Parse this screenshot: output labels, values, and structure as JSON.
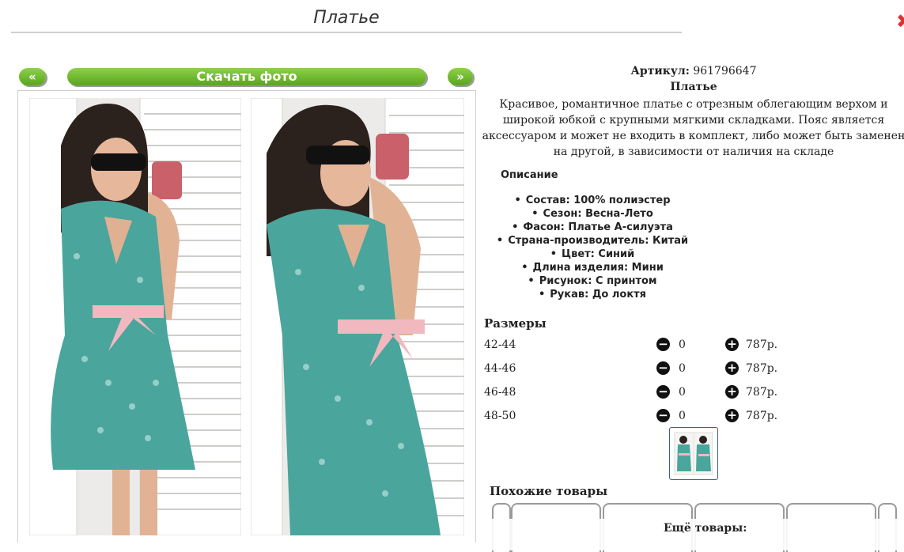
{
  "page": {
    "title": "Платье",
    "close_icon": "close-icon",
    "accent": "#6cb52c"
  },
  "nav": {
    "prev_label": "«",
    "next_label": "»",
    "download_label": "Скачать фото"
  },
  "product": {
    "article_label": "Артикул:",
    "article_value": "961796647",
    "name": "Платье",
    "description": "Красивое, романтичное платье с отрезным облегающим верхом и широкой юбкой с крупными мягкими складками. Пояс является аксессуаром и может не входить в комплект, либо может быть заменен на другой, в зависимости от наличия на складе"
  },
  "specs": {
    "heading": "Описание",
    "items": [
      "Состав: 100% полиэстер",
      "Сезон: Весна-Лето",
      "Фасон: Платье А-силуэта",
      "Страна-производитель: Китай",
      "Цвет: Синий",
      "Длина изделия: Мини",
      "Рисунок: С принтом",
      "Рукав: До локтя"
    ]
  },
  "sizes": {
    "heading": "Размеры",
    "rows": [
      {
        "size": "42-44",
        "qty": "0",
        "price": "787р."
      },
      {
        "size": "44-46",
        "qty": "0",
        "price": "787р."
      },
      {
        "size": "46-48",
        "qty": "0",
        "price": "787р."
      },
      {
        "size": "48-50",
        "qty": "0",
        "price": "787р."
      }
    ]
  },
  "related": {
    "similar_heading": "Похожие товары",
    "more_heading": "Ещё товары:"
  }
}
